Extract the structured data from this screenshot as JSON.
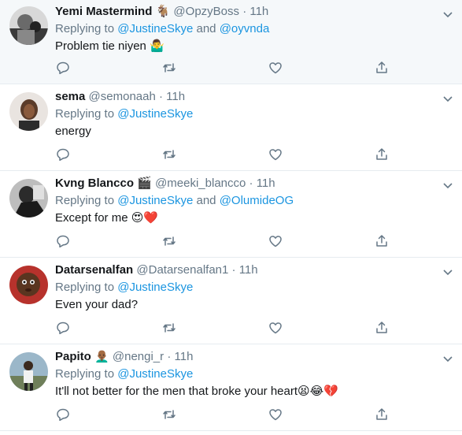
{
  "tweets": [
    {
      "name": "Yemi Mastermind",
      "name_emoji": "🐐",
      "handle": "@OpzyBoss",
      "time": "11h",
      "replying_prefix": "Replying to",
      "mentions": [
        "@JustineSkye",
        "@oyvnda"
      ],
      "joiner": "and",
      "text": "Problem tie niyen",
      "text_emoji": "🤷‍♂️"
    },
    {
      "name": "sema",
      "name_emoji": "",
      "handle": "@semonaah",
      "time": "11h",
      "replying_prefix": "Replying to",
      "mentions": [
        "@JustineSkye"
      ],
      "joiner": "",
      "text": "energy",
      "text_emoji": ""
    },
    {
      "name": "Kvng Blancco",
      "name_emoji": "🎬",
      "handle": "@meeki_blancco",
      "time": "11h",
      "replying_prefix": "Replying to",
      "mentions": [
        "@JustineSkye",
        "@OlumideOG"
      ],
      "joiner": "and",
      "text": "Except for me",
      "text_emoji": "😍❤️"
    },
    {
      "name": "Datarsenalfan",
      "name_emoji": "",
      "handle": "@Datarsenalfan1",
      "time": "11h",
      "replying_prefix": "Replying to",
      "mentions": [
        "@JustineSkye"
      ],
      "joiner": "",
      "text": "Even your dad?",
      "text_emoji": ""
    },
    {
      "name": "Papito",
      "name_emoji": "👨🏾‍🦲",
      "handle": "@nengi_r",
      "time": "11h",
      "replying_prefix": "Replying to",
      "mentions": [
        "@JustineSkye"
      ],
      "joiner": "",
      "text": "It'll not better for the men that broke your heart",
      "text_emoji": "😫😂💔"
    }
  ],
  "separator": "·",
  "icons": {
    "reply": "reply-icon",
    "retweet": "retweet-icon",
    "like": "like-icon",
    "share": "share-icon",
    "more": "chevron-down-icon"
  },
  "colors": {
    "link": "#1b95e0",
    "muted": "#657786",
    "highlight_bg": "#f5f8fa",
    "divider": "#e6ecf0"
  }
}
